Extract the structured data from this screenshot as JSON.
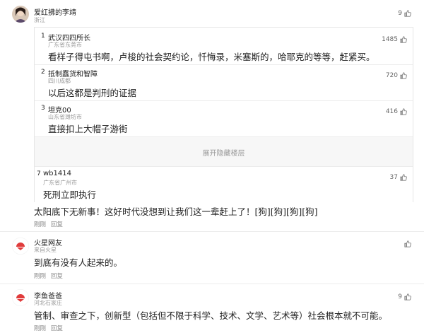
{
  "comments": [
    {
      "author": "爱红拂的李靖",
      "location": "浙江",
      "likes": "9",
      "replies": [
        {
          "index": "1",
          "author": "武汉四四所长",
          "location": "广东省东莞市",
          "text": "看样子得屯书啊，卢梭的社会契约论，忏悔录，米塞斯的，哈耶克的等等，赶紧买。",
          "likes": "1485"
        },
        {
          "index": "2",
          "author": "抵制蠢货和智障",
          "location": "四川成都",
          "text": "以后这都是判刑的证据",
          "likes": "720"
        },
        {
          "index": "3",
          "author": "坦克00",
          "location": "山东省潍坊市",
          "text": "直接扣上大帽子游街",
          "likes": "416"
        }
      ],
      "expand_label": "展开隐藏楼层",
      "last_reply": {
        "index": "7",
        "author": "wb1414",
        "location": "广东省广州市",
        "text": "死刑立即执行",
        "likes": "37"
      },
      "text": "太阳底下无新事！这好时代没想到让我们这一辈赶上了！[狗][狗][狗][狗]",
      "time": "刚刚",
      "reply_label": "回复"
    },
    {
      "author": "火星网友",
      "location": "来自火星",
      "text": "到底有没有人起来的。",
      "time": "刚刚",
      "reply_label": "回复"
    },
    {
      "author": "李鱼爸爸",
      "location": "河北石家庄",
      "likes": "9",
      "text": "管制、审查之下，创新型（包括但不限于科学、技术、文学、艺术等）社会根本就不可能。",
      "time": "刚刚",
      "reply_label": "回复"
    }
  ],
  "colors": {
    "brand_red": "#e03b3b",
    "link_gray": "#999999"
  }
}
